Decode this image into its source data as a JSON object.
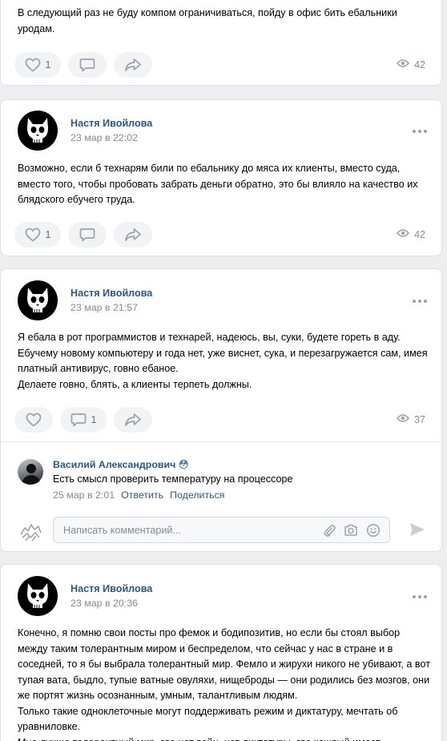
{
  "posts": [
    {
      "text": "В следующий раз не буду компом ограничиваться, пойду в офис бить ебальники уродам.",
      "likes": "1",
      "views": "42"
    },
    {
      "author": "Настя Ивойлова",
      "date": "23 мар в 22:02",
      "text": "Возможно, если б технарям били по ебальнику до мяса их клиенты, вместо суда, вместо того, чтобы пробовать забрать деньги обратно, это бы влияло на качество их блядского ебучего труда.",
      "likes": "1",
      "views": "42"
    },
    {
      "author": "Настя Ивойлова",
      "date": "23 мар в 21:57",
      "text": "Я ебала в рот программистов и технарей, надеюсь, вы, суки, будете гореть в аду. Ебучему новому компьютеру и года нет, уже виснет, сука, и перезагружается сам, имея платный антивирус, говно ебаное.\nДелаете говно, блять, а клиенты терпеть должны.",
      "comments": "1",
      "views": "37",
      "comment": {
        "author": "Василий Александрович",
        "emoji": "😳",
        "text": "Есть смысл проверить температуру на процессоре",
        "date": "25 мар в 2:01",
        "reply": "Ответить",
        "share": "Поделиться"
      },
      "comment_placeholder": "Написать комментарий..."
    },
    {
      "author": "Настя Ивойлова",
      "date": "23 мар в 20:36",
      "text": "Конечно, я помню свои посты про фемок и бодипозитив, но если бы стоял выбор между таким толерантным миром и беспределом, что сейчас у нас в стране и в соседней, то я бы выбрала толерантный мир. Фемло и жирухи никого не убивают, а вот тупая вата, быдло, тупые ватные овуляхи, нищеброды — они родились без мозгов, они же портят жизнь осознанным, умным, талантливым людям.\nТолько такие одноклеточные могут поддерживать режим и диктатуру, мечтать об уравниловке.\nМне лучше толерантный мир, где нет войн, нет диктатуры, где каждый имеет"
    }
  ],
  "colors": {
    "link": "#2a5885",
    "muted": "#818c99",
    "pill": "#f2f3f5",
    "bg": "#edeef0"
  },
  "icons": [
    "heart-icon",
    "comment-icon",
    "share-icon",
    "eye-icon",
    "more-icon",
    "paperclip-icon",
    "camera-icon",
    "smile-icon",
    "send-icon"
  ]
}
